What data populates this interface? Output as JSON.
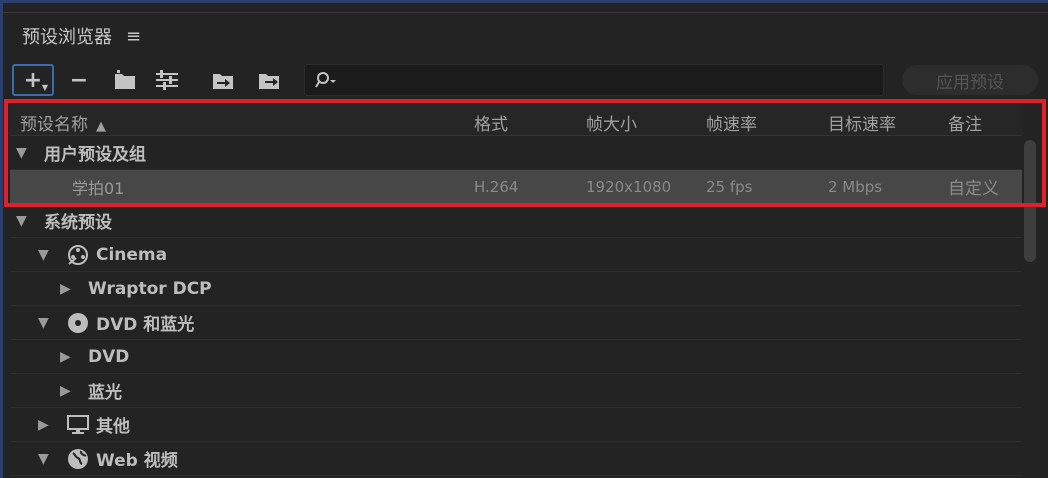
{
  "panel": {
    "title": "预设浏览器",
    "menu_icon": "hamburger-icon"
  },
  "toolbar": {
    "add_label": "+",
    "remove_label": "−",
    "search_placeholder": "",
    "apply_label": "应用预设"
  },
  "columns": {
    "name": "预设名称",
    "format": "格式",
    "frame_size": "帧大小",
    "frame_rate": "帧速率",
    "target_rate": "目标速率",
    "notes": "备注"
  },
  "rows": [
    {
      "label": "用户预设及组"
    },
    {
      "label": "学拍01",
      "format": "H.264",
      "frame_size": "1920x1080",
      "frame_rate": "25 fps",
      "target_rate": "2 Mbps",
      "notes": "自定义"
    },
    {
      "label": "系统预设"
    },
    {
      "label": "Cinema",
      "icon": "film-reel-icon"
    },
    {
      "label": "Wraptor DCP"
    },
    {
      "label": "DVD 和蓝光",
      "icon": "disc-icon"
    },
    {
      "label": "DVD"
    },
    {
      "label": "蓝光"
    },
    {
      "label": "其他",
      "icon": "monitor-icon"
    },
    {
      "label": "Web 视频",
      "icon": "globe-icon"
    }
  ],
  "colors": {
    "highlight": "#e0202b",
    "accent": "#3d6bb0",
    "selected_row": "#474747"
  }
}
